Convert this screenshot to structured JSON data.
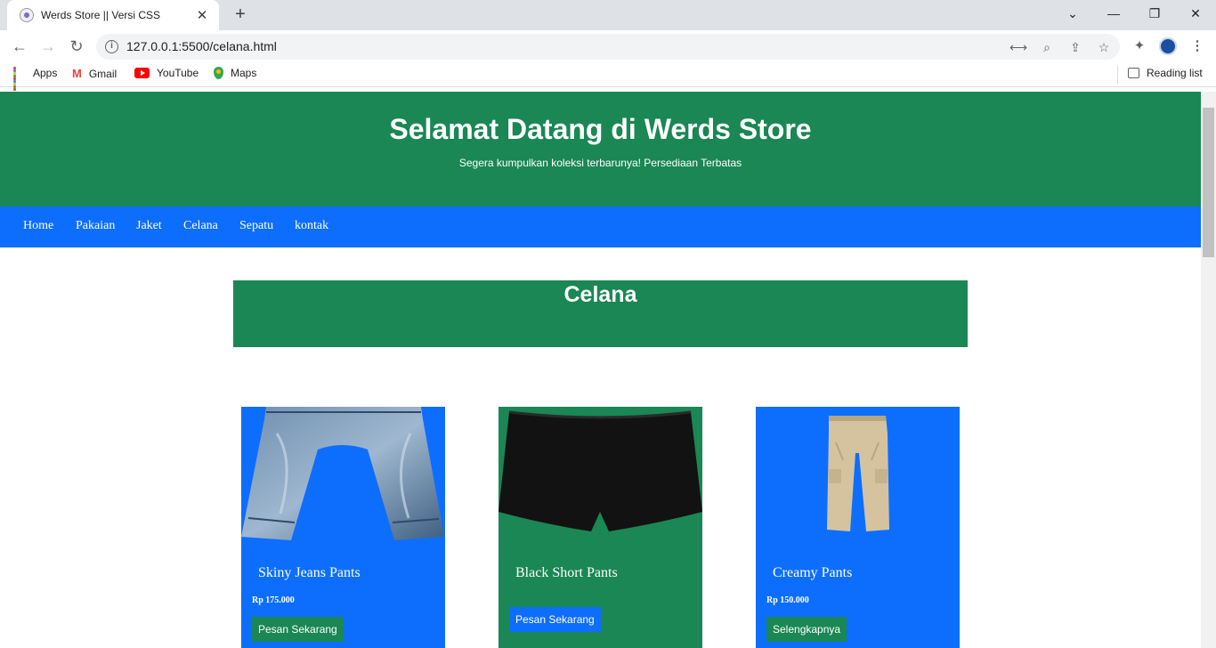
{
  "browser": {
    "tab_title": "Werds Store || Versi CSS",
    "url": "127.0.0.1:5500/celana.html",
    "bookmarks": [
      "Apps",
      "Gmail",
      "YouTube",
      "Maps"
    ],
    "reading_list": "Reading list"
  },
  "hero": {
    "title": "Selamat Datang di Werds Store",
    "subtitle": "Segera kumpulkan koleksi terbarunya! Persediaan Terbatas"
  },
  "nav": [
    "Home",
    "Pakaian",
    "Jaket",
    "Celana",
    "Sepatu",
    "kontak"
  ],
  "section": {
    "title": "Celana"
  },
  "products": [
    {
      "name": "Skiny Jeans Pants",
      "price": "Rp 175.000",
      "button": "Pesan Sekarang"
    },
    {
      "name": "Black Short Pants",
      "price": "",
      "button": "Pesan Sekarang"
    },
    {
      "name": "Creamy Pants",
      "price": "Rp 150.000",
      "button": "Selengkapnya"
    }
  ],
  "colors": {
    "green": "#1a8754",
    "blue": "#0d6efd"
  }
}
